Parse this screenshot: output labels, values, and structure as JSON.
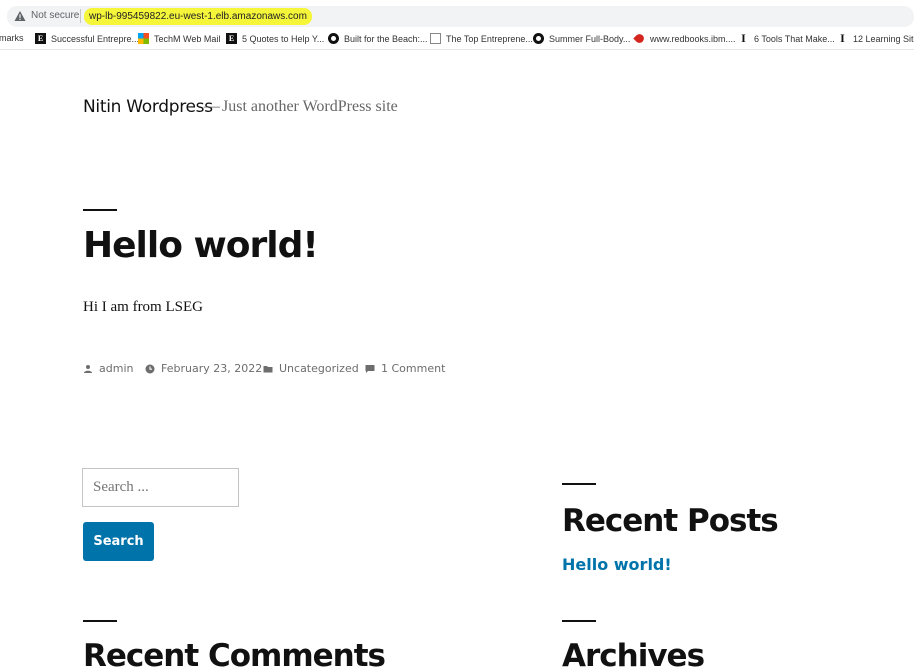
{
  "browser": {
    "security_label": "Not secure",
    "url": "wp-lb-995459822.eu-west-1.elb.amazonaws.com",
    "highlight_color": "#f5f53a"
  },
  "bookmarks": [
    {
      "label": "rmarks",
      "icon": "none"
    },
    {
      "label": "Successful Entrepre...",
      "icon": "e-icon"
    },
    {
      "label": "TechM Web Mail",
      "icon": "microsoft-icon"
    },
    {
      "label": "5 Quotes to Help Y...",
      "icon": "e-icon"
    },
    {
      "label": "Built for the Beach:...",
      "icon": "circle-icon"
    },
    {
      "label": "The Top Entreprene...",
      "icon": "doc-icon"
    },
    {
      "label": "Summer Full-Body...",
      "icon": "circle-icon"
    },
    {
      "label": "www.redbooks.ibm....",
      "icon": "red-pin-icon"
    },
    {
      "label": "6 Tools That Make...",
      "icon": "i-icon"
    },
    {
      "label": "12 Learning Site",
      "icon": "i-icon"
    }
  ],
  "site": {
    "title": "Nitin Wordpress",
    "dash": "—",
    "description": "Just another WordPress site"
  },
  "post": {
    "title": "Hello world!",
    "body": "Hi I am from LSEG",
    "author": "admin",
    "date": "February 23, 2022",
    "category": "Uncategorized",
    "comments": "1 Comment"
  },
  "search": {
    "placeholder": "Search ...",
    "button_label": "Search"
  },
  "widgets": {
    "recent_posts_title": "Recent Posts",
    "recent_posts": [
      "Hello world!"
    ],
    "recent_comments_title": "Recent Comments",
    "archives_title": "Archives"
  },
  "colors": {
    "accent": "#0073aa",
    "meta_gray": "#6d6d6d"
  }
}
